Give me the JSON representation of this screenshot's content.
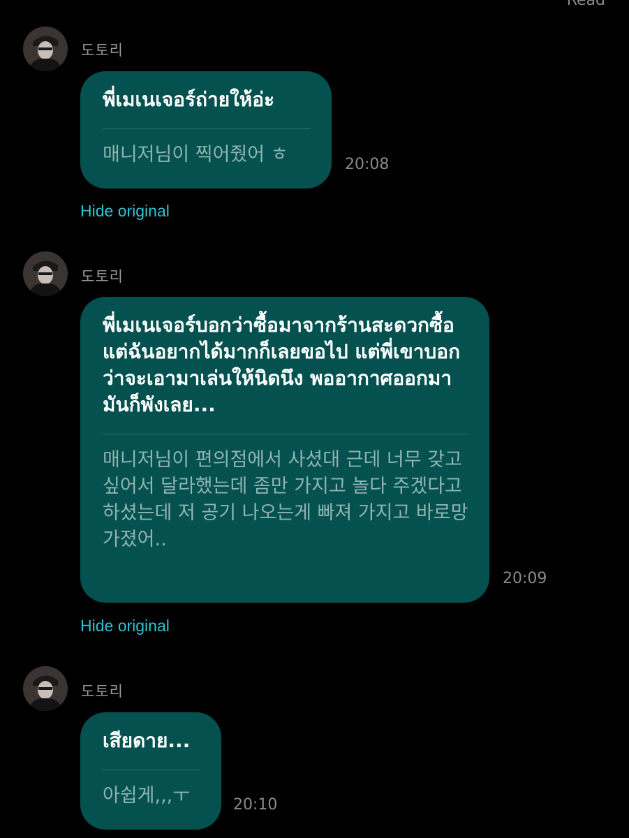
{
  "header": {
    "read_label": "Read"
  },
  "messages": [
    {
      "sender": "도토리",
      "translation": "พี่เมเนเจอร์ถ่ายให้อ่ะ",
      "original": "매니저님이 찍어줬어 ㅎ",
      "time": "20:08",
      "hide_label": "Hide original"
    },
    {
      "sender": "도토리",
      "translation": "พี่เมเนเจอร์บอกว่าซื้อมาจากร้านสะดวกซื้อ แต่ฉันอยากได้มากก็เลยขอไป แต่พี่เขาบอกว่าจะเอามาเล่นให้นิดนึง พออากาศออกมามันก็พังเลย...",
      "original": "매니저님이 편의점에서 사셨대 근데 너무 갖고싶어서 달라했는데 좀만 가지고 놀다 주겠다고 하셨는데 저 공기 나오는게 빠져 가지고 바로망가졌어..",
      "time": "20:09",
      "hide_label": "Hide original"
    },
    {
      "sender": "도토리",
      "translation": "เสียดาย...",
      "original": "아쉽게,,,ㅜ",
      "time": "20:10"
    }
  ],
  "colors": {
    "background": "#000000",
    "bubble": "#04514f",
    "link": "#2ec4d4",
    "muted": "#8a8a8a"
  }
}
